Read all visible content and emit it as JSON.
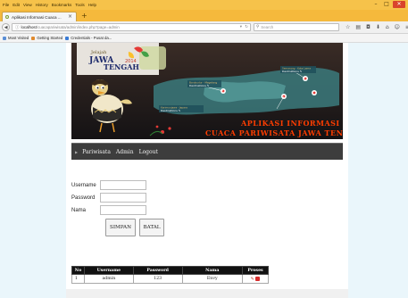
{
  "browser": {
    "menu": [
      "File",
      "Edit",
      "View",
      "History",
      "Bookmarks",
      "Tools",
      "Help"
    ],
    "tab_title": "Aplikasi Informasi Cuaca ...",
    "url_host": "localhost",
    "url_path": "/cuacapariwisata/admin/index.php?page=admin",
    "search_placeholder": "Search",
    "bookmarks": [
      "Most Visited",
      "Getting Started",
      "Credentials - Pusat da..."
    ]
  },
  "site": {
    "menu_items": [
      "Pariwisata",
      "Admin",
      "Logout"
    ]
  },
  "form": {
    "username_label": "Username",
    "password_label": "Password",
    "nama_label": "Nama",
    "save_label": "SIMPAN",
    "cancel_label": "BATAL"
  },
  "table": {
    "headers": [
      "No",
      "Username",
      "Password",
      "Nama",
      "Proses"
    ],
    "rows": [
      {
        "no": "1",
        "username": "admin",
        "password": "123",
        "nama": "Envy"
      }
    ]
  },
  "colors": {
    "firefox_orange": "#f5b93c",
    "menu_strip": "#3d3d3d",
    "banner_title": "#ff3d00"
  }
}
